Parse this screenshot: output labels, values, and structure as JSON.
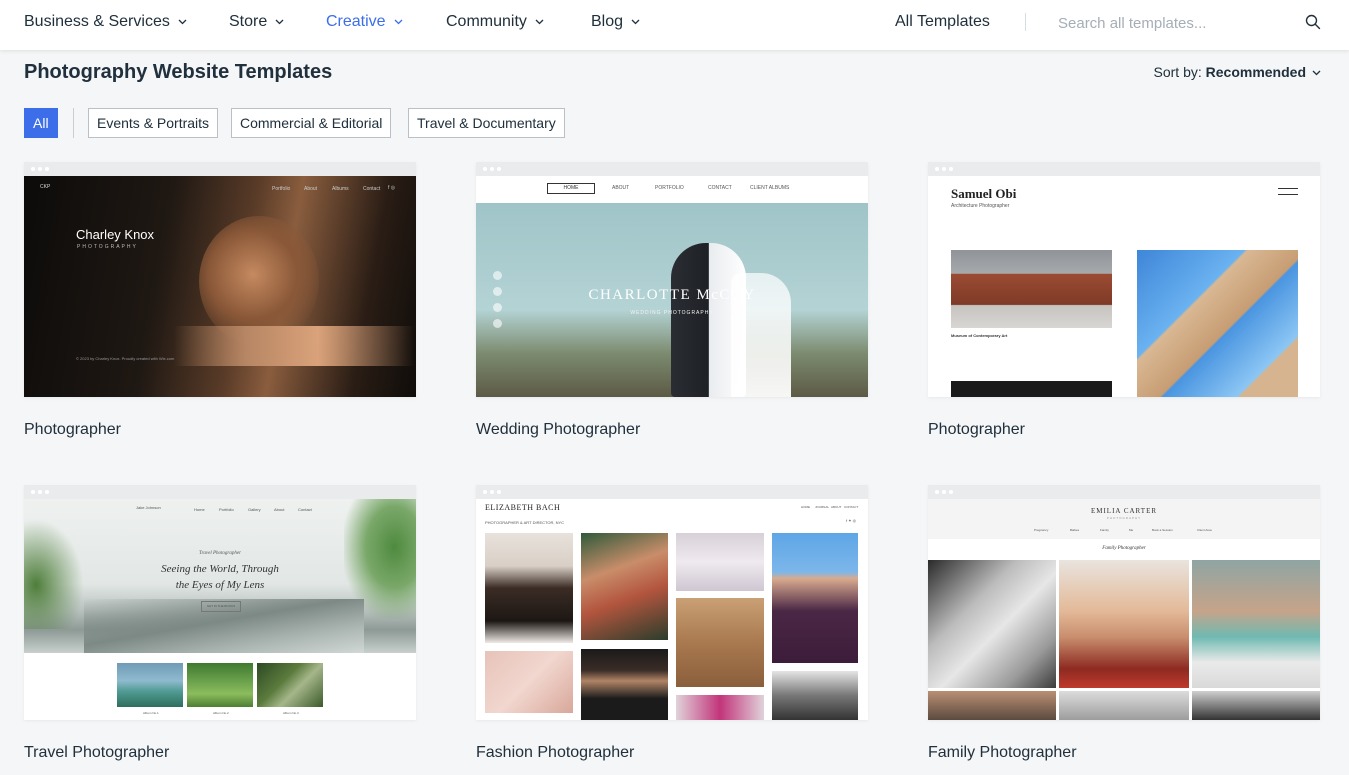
{
  "nav": {
    "items": [
      {
        "label": "Business & Services"
      },
      {
        "label": "Store"
      },
      {
        "label": "Creative"
      },
      {
        "label": "Community"
      },
      {
        "label": "Blog"
      }
    ],
    "all_templates": "All Templates",
    "search_placeholder": "Search all templates...",
    "icons": {
      "dropdown": "chevron-down-icon",
      "search": "search-icon"
    }
  },
  "page": {
    "title": "Photography Website Templates",
    "sort_label": "Sort by:",
    "sort_value": "Recommended"
  },
  "filters": [
    {
      "label": "All",
      "selected": true
    },
    {
      "label": "Events & Portraits",
      "selected": false
    },
    {
      "label": "Commercial & Editorial",
      "selected": false
    },
    {
      "label": "Travel & Documentary",
      "selected": false
    }
  ],
  "colors": {
    "accent": "#3b6ee8",
    "text": "#20303c",
    "background": "#f5f6f7"
  },
  "templates": [
    {
      "name": "Photographer",
      "preview": {
        "logo": "CKP",
        "nav": [
          "Portfolio",
          "About",
          "Albums",
          "Contact"
        ],
        "title": "Charley Knox",
        "subtitle": "PHOTOGRAPHY",
        "footer": "© 2023 by Charley Knox. Proudly created with Wix.com"
      }
    },
    {
      "name": "Wedding Photographer",
      "preview": {
        "nav": [
          "HOME",
          "ABOUT",
          "PORTFOLIO",
          "CONTACT",
          "CLIENT ALBUMS"
        ],
        "title": "CHARLOTTE McCOY",
        "subtitle": "WEDDING PHOTOGRAPHY"
      }
    },
    {
      "name": "Photographer",
      "preview": {
        "title": "Samuel Obi",
        "subtitle": "Architecture Photographer",
        "caption": "Museum of Contemporary Art"
      }
    },
    {
      "name": "Travel Photographer",
      "preview": {
        "logo": "Jake Johnson",
        "nav": [
          "Home",
          "Portfolio",
          "Gallery",
          "About",
          "Contact"
        ],
        "kicker": "Travel Photographer",
        "headline_line1": "Seeing the World, Through",
        "headline_line2": "the Eyes of My Lens",
        "button": "GET IN THE BOOKS",
        "captions": [
          "Album No.1",
          "Album No.2",
          "Album No.3"
        ]
      }
    },
    {
      "name": "Fashion Photographer",
      "preview": {
        "title": "ELIZABETH BACH",
        "nav": [
          "HOME",
          "JOURNAL",
          "ABOUT",
          "CONTACT"
        ],
        "subtitle": "PHOTOGRAPHER & ART DIRECTOR, NYC"
      }
    },
    {
      "name": "Family Photographer",
      "preview": {
        "title": "EMILIA CARTER",
        "subtitle": "PHOTOGRAPHY",
        "nav": [
          "Pregnancy",
          "Babies",
          "Family",
          "Me",
          "Book a Session",
          "Client Area"
        ],
        "kicker": "Family Photographer"
      }
    }
  ]
}
